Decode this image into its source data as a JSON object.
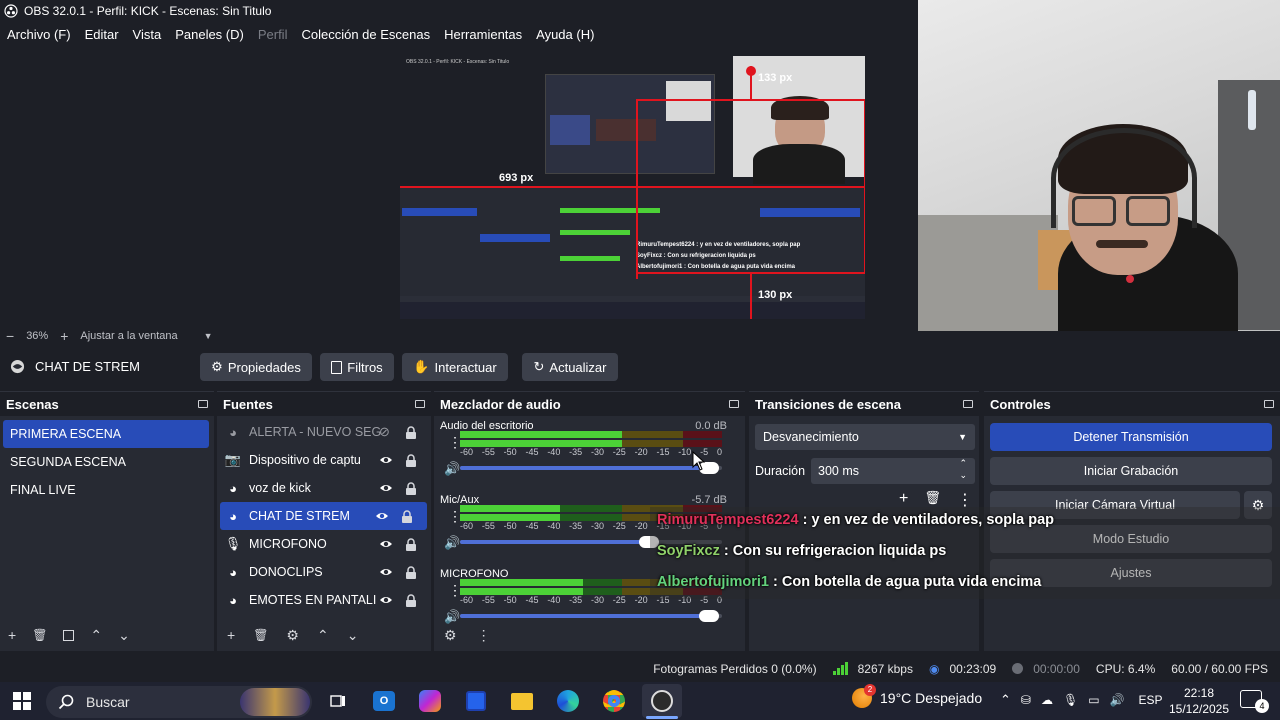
{
  "window": {
    "title": "OBS 32.0.1 - Perfil: KICK - Escenas: Sin Titulo"
  },
  "menu": {
    "items": [
      "Archivo (F)",
      "Editar",
      "Vista",
      "Paneles (D)",
      "Perfil",
      "Colección de Escenas",
      "Herramientas",
      "Ayuda (H)"
    ]
  },
  "preview": {
    "overlay_labels": {
      "px_693": "693 px",
      "px_133": "133 px",
      "px_130": "130 px"
    },
    "nested_title": "OBS 32.0.1 - Perfil: KICK - Escenas: Sin Titulo",
    "nested_chat": [
      "RimuruTempest6224 : y en vez de ventiladores, sopla pap",
      "SoyFixcz : Con su refrigeracion liquida ps",
      "Albertofujimori1 : Con botella de agua puta vida encima"
    ]
  },
  "zoom": {
    "value": "36%",
    "fit_label": "Ajustar a la ventana"
  },
  "source_toolbar": {
    "current_source": "CHAT DE STREM",
    "buttons": [
      "Propiedades",
      "Filtros",
      "Interactuar",
      "Actualizar"
    ]
  },
  "scenes": {
    "title": "Escenas",
    "items": [
      "PRIMERA ESCENA",
      "SEGUNDA ESCENA",
      "FINAL LIVE"
    ]
  },
  "sources": {
    "title": "Fuentes",
    "items": [
      "ALERTA - NUEVO SEG",
      "Dispositivo de captu",
      "voz de kick",
      "CHAT DE STREM",
      "MICROFONO",
      "DONOCLIPS",
      "EMOTES EN PANTALI"
    ]
  },
  "mixer": {
    "title": "Mezclador de audio",
    "ticks": [
      "-60",
      "-55",
      "-50",
      "-45",
      "-40",
      "-35",
      "-30",
      "-25",
      "-20",
      "-15",
      "-10",
      "-5",
      "0"
    ],
    "channels": [
      {
        "name": "Audio del escritorio",
        "db": "0.0 dB",
        "level": 0.62,
        "volume": 0.95
      },
      {
        "name": "Mic/Aux",
        "db": "-5.7 dB",
        "level": 0.38,
        "volume": 0.72
      },
      {
        "name": "MICROFONO",
        "db": "",
        "level": 0.47,
        "volume": 0.95
      }
    ]
  },
  "transitions": {
    "title": "Transiciones de escena",
    "selected": "Desvanecimiento",
    "duration_label": "Duración",
    "duration_value": "300 ms"
  },
  "controls": {
    "title": "Controles",
    "stop_stream": "Detener Transmisión",
    "start_recording": "Iniciar Grabación",
    "start_virtual_cam": "Iniciar Cámara Virtual",
    "studio_mode": "Modo Estudio",
    "settings": "Ajustes"
  },
  "chat_overlay": [
    {
      "user": "RimuruTempest6224",
      "message": " : y en vez de ventiladores, sopla pap",
      "color": "#e0305a"
    },
    {
      "user": "SoyFixcz",
      "message": " : Con su refrigeracion liquida ps",
      "color": "#8fd16a"
    },
    {
      "user": "Albertofujimori1",
      "message": " : Con botella de agua puta vida encima",
      "color": "#63d27d"
    }
  ],
  "status": {
    "dropped_frames": "Fotogramas Perdidos 0 (0.0%)",
    "bitrate": "8267 kbps",
    "stream_time": "00:23:09",
    "rec_time": "00:00:00",
    "cpu": "CPU: 6.4%",
    "fps": "60.00 / 60.00 FPS"
  },
  "taskbar": {
    "search_label": "Buscar",
    "weather": "19°C  Despejado",
    "lang": "ESP",
    "time": "22:18",
    "date": "15/12/2025",
    "weather_badge": "2",
    "notification_count": "4"
  },
  "colors": {
    "accent": "#284cb8",
    "panel": "#272a33",
    "background": "#1d1f26",
    "meter_green": "#4cd137",
    "meter_yellow": "#c4a81a",
    "meter_red": "#b3202e"
  }
}
